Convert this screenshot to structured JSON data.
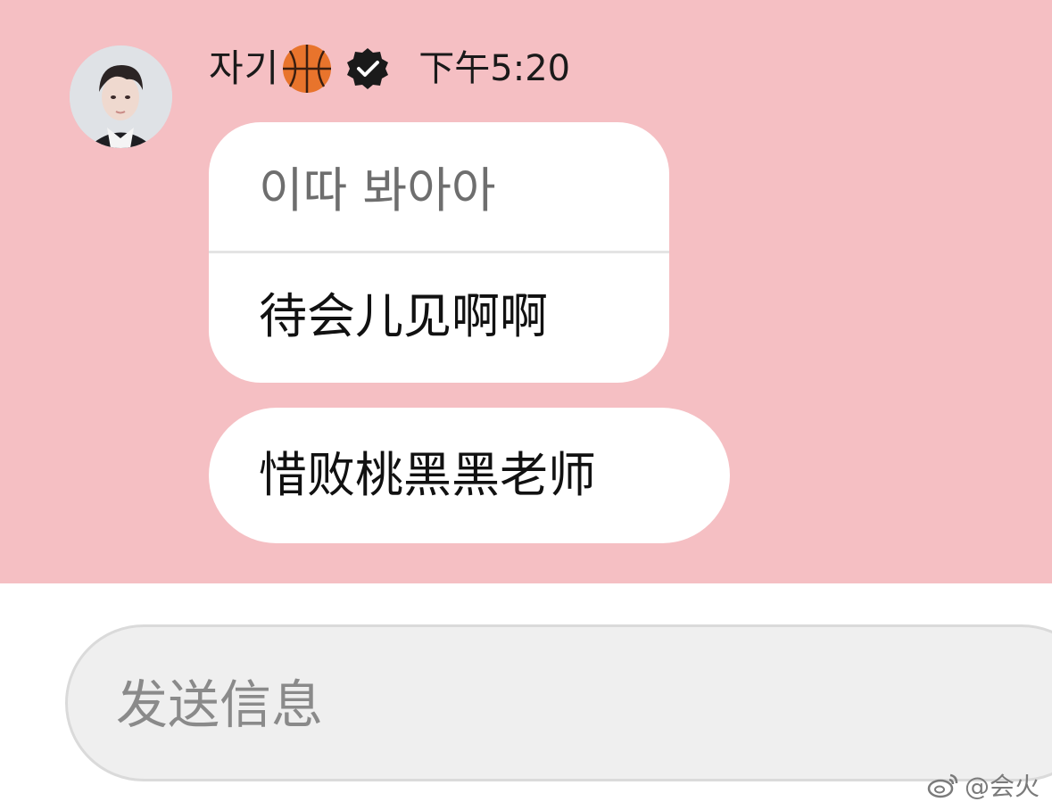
{
  "chat": {
    "background_color": "#f5bfc3",
    "sender": {
      "name": "자기",
      "name_emoji_icon": "basketball-icon",
      "verified_icon": "verified-badge-icon",
      "avatar_icon": "avatar"
    },
    "timestamp": "下午5:20",
    "messages": [
      {
        "original_text": "이따 봐아아",
        "translation": "待会儿见啊啊"
      },
      {
        "text": "惜败桃黑黑老师"
      }
    ]
  },
  "composer": {
    "placeholder": "发送信息"
  },
  "watermark": {
    "icon": "weibo-icon",
    "text": "@会火"
  }
}
